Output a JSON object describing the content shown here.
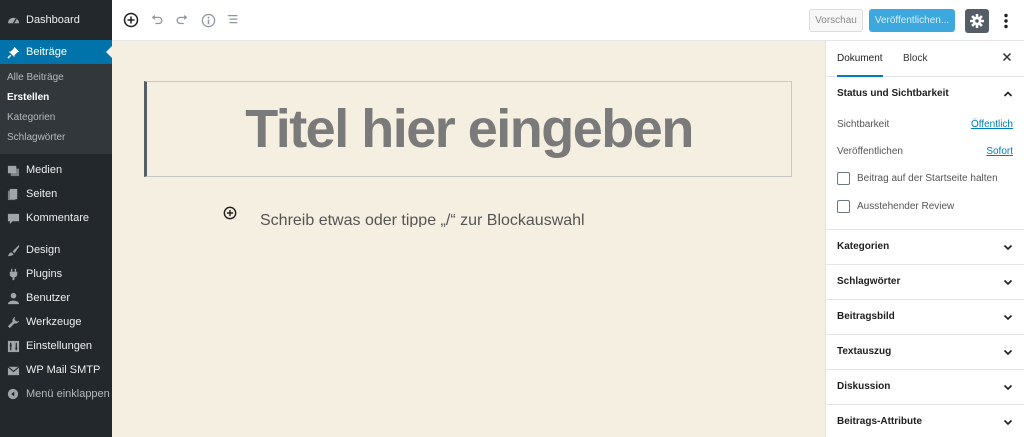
{
  "sidebar": {
    "dashboard": "Dashboard",
    "posts": "Beiträge",
    "posts_sub": [
      "Alle Beiträge",
      "Erstellen",
      "Kategorien",
      "Schlagwörter"
    ],
    "media": "Medien",
    "pages": "Seiten",
    "comments": "Kommentare",
    "design": "Design",
    "plugins": "Plugins",
    "users": "Benutzer",
    "tools": "Werkzeuge",
    "settings": "Einstellungen",
    "smtp": "WP Mail SMTP",
    "collapse": "Menü einklappen"
  },
  "toolbar": {
    "preview_label": "Vorschau",
    "publish_label": "Veröffentlichen..."
  },
  "editor": {
    "title_placeholder": "Titel hier eingeben",
    "paragraph_placeholder": "Schreib etwas oder tippe „/“ zur Blockauswahl"
  },
  "panel": {
    "tab_document": "Dokument",
    "tab_block": "Block",
    "status_section": "Status und Sichtbarkeit",
    "visibility_label": "Sichtbarkeit",
    "visibility_value": "Öffentlich",
    "publish_label": "Veröffentlichen",
    "publish_value": "Sofort",
    "sticky_label": "Beitrag auf der Startseite halten",
    "review_label": "Ausstehender Review",
    "sections": [
      "Kategorien",
      "Schlagwörter",
      "Beitragsbild",
      "Textauszug",
      "Diskussion",
      "Beitrags-Attribute"
    ]
  },
  "colors": {
    "sidebar_bg": "#23282d",
    "accent": "#0073aa",
    "publish": "#3da8de",
    "editor_bg": "#f5efe1"
  }
}
